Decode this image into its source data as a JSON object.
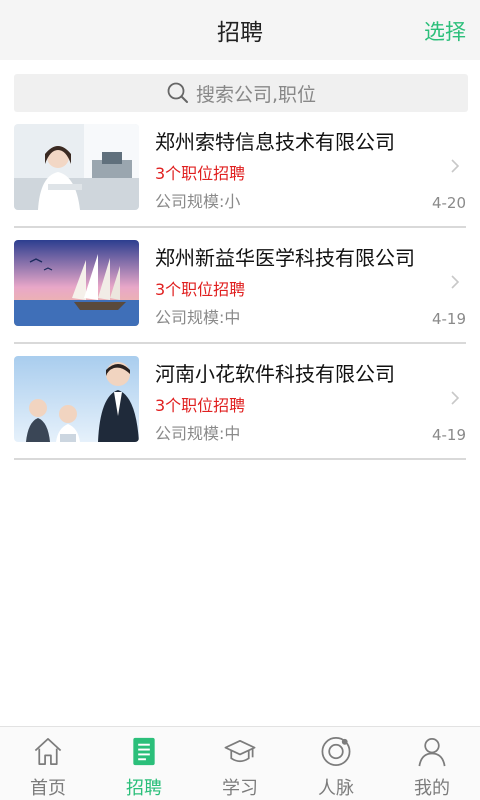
{
  "header": {
    "title": "招聘",
    "action": "选择"
  },
  "search": {
    "placeholder": "搜索公司,职位",
    "icon": "search-icon"
  },
  "companies": [
    {
      "name": "郑州索特信息技术有限公司",
      "positions": "3个职位招聘",
      "scale": "公司规模:小",
      "date": "4-20"
    },
    {
      "name": "郑州新益华医学科技有限公司",
      "positions": "3个职位招聘",
      "scale": "公司规模:中",
      "date": "4-19"
    },
    {
      "name": "河南小花软件科技有限公司",
      "positions": "3个职位招聘",
      "scale": "公司规模:中",
      "date": "4-19"
    }
  ],
  "nav": [
    {
      "label": "首页",
      "icon": "home-icon",
      "active": false
    },
    {
      "label": "招聘",
      "icon": "job-list-icon",
      "active": true
    },
    {
      "label": "学习",
      "icon": "graduation-cap-icon",
      "active": false
    },
    {
      "label": "人脉",
      "icon": "network-icon",
      "active": false
    },
    {
      "label": "我的",
      "icon": "user-icon",
      "active": false
    }
  ],
  "colors": {
    "accent": "#2bbf7a",
    "alert": "#e02020",
    "muted": "#8a8a8a"
  }
}
